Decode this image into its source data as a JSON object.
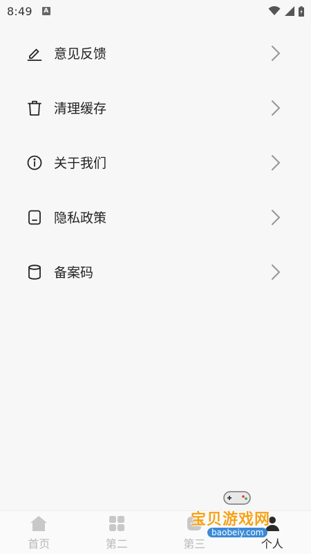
{
  "status": {
    "time": "8:49",
    "notif_letter": "A"
  },
  "menu": [
    {
      "label": "意见反馈",
      "icon": "edit-icon"
    },
    {
      "label": "清理缓存",
      "icon": "trash-icon"
    },
    {
      "label": "关于我们",
      "icon": "info-icon"
    },
    {
      "label": "隐私政策",
      "icon": "document-icon"
    },
    {
      "label": "备案码",
      "icon": "database-icon"
    }
  ],
  "tabbar": {
    "tabs": [
      {
        "label": "首页",
        "icon": "home-icon",
        "active": false
      },
      {
        "label": "第二",
        "icon": "grid-icon",
        "active": false
      },
      {
        "label": "第三",
        "icon": "cube-icon",
        "active": false
      },
      {
        "label": "个人",
        "icon": "person-icon",
        "active": true
      }
    ]
  },
  "watermark": {
    "title": "宝贝游戏网",
    "url": "baobeiy.com"
  },
  "colors": {
    "background": "#f7f7f7",
    "text": "#222222",
    "chevron": "#9a9a9a",
    "tab_inactive": "#b9b9b9",
    "watermark": "#f5a21a"
  }
}
